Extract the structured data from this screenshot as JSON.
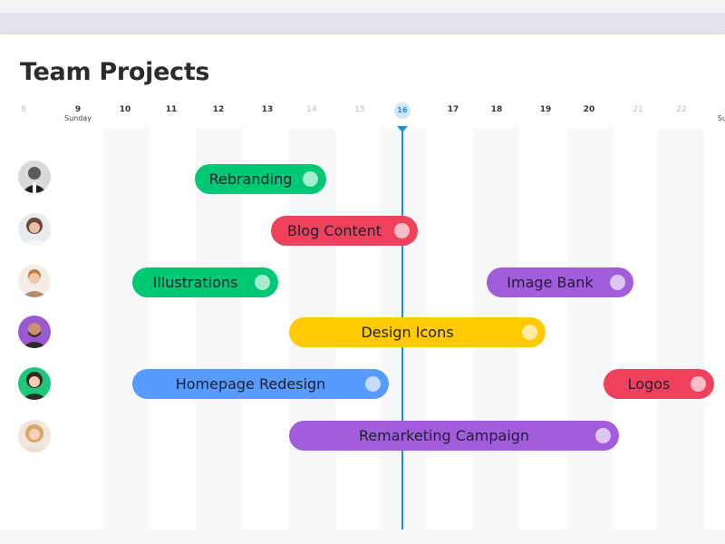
{
  "title": "Team Projects",
  "colors": {
    "green": "#00c875",
    "red": "#f0415c",
    "purple": "#a25ddc",
    "yellow": "#ffcb00",
    "blue": "#579bfc",
    "today": "#1d8fe0"
  },
  "timeline": {
    "days": [
      {
        "label": "8",
        "sub": "",
        "weekend": true
      },
      {
        "label": "9",
        "sub": "Sunday",
        "weekend": false
      },
      {
        "label": "10",
        "sub": "",
        "weekend": false
      },
      {
        "label": "11",
        "sub": "",
        "weekend": false
      },
      {
        "label": "12",
        "sub": "",
        "weekend": false
      },
      {
        "label": "13",
        "sub": "",
        "weekend": false
      },
      {
        "label": "14",
        "sub": "",
        "weekend": true
      },
      {
        "label": "15",
        "sub": "",
        "weekend": true
      },
      {
        "label": "16",
        "sub": "",
        "weekend": false,
        "today": true
      },
      {
        "label": "17",
        "sub": "",
        "weekend": false
      },
      {
        "label": "18",
        "sub": "",
        "weekend": false
      },
      {
        "label": "19",
        "sub": "",
        "weekend": false
      },
      {
        "label": "20",
        "sub": "",
        "weekend": false
      },
      {
        "label": "21",
        "sub": "",
        "weekend": true
      },
      {
        "label": "22",
        "sub": "",
        "weekend": true
      },
      {
        "label": "",
        "sub": "Su",
        "weekend": false
      }
    ]
  },
  "rows": [
    {
      "avatar": "avatar-person-1",
      "tasks": [
        {
          "label": "Rebranding",
          "color": "green"
        }
      ]
    },
    {
      "avatar": "avatar-person-2",
      "tasks": [
        {
          "label": "Blog Content",
          "color": "red"
        }
      ]
    },
    {
      "avatar": "avatar-person-3",
      "tasks": [
        {
          "label": "Illustrations",
          "color": "green"
        },
        {
          "label": "Image Bank",
          "color": "purple"
        }
      ]
    },
    {
      "avatar": "avatar-person-4",
      "tasks": [
        {
          "label": "Design Icons",
          "color": "yellow"
        }
      ]
    },
    {
      "avatar": "avatar-person-5",
      "tasks": [
        {
          "label": "Homepage Redesign",
          "color": "blue"
        },
        {
          "label": "Logos",
          "color": "red"
        }
      ]
    },
    {
      "avatar": "avatar-person-6",
      "tasks": [
        {
          "label": "Remarketing Campaign",
          "color": "purple"
        }
      ]
    }
  ]
}
